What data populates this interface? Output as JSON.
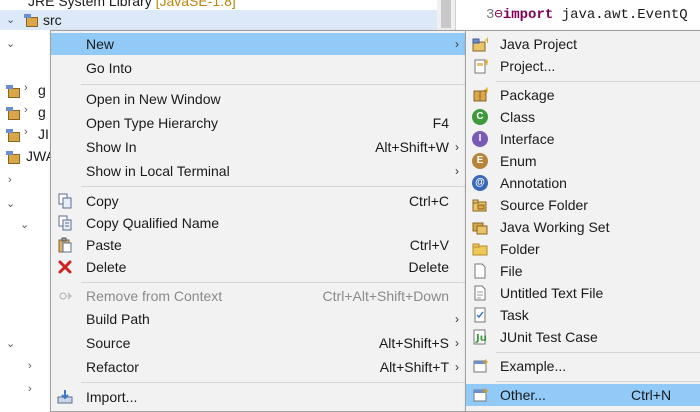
{
  "explorer": {
    "top_partial_text": "JRE System Library",
    "top_partial_tag": "[JavaSE-1.8]",
    "selected_label": "src",
    "rows": [
      {
        "arrow": "›",
        "label": "g"
      },
      {
        "arrow": "›",
        "label": "g"
      },
      {
        "arrow": "›",
        "label": "JI"
      },
      {
        "arrow": "",
        "label": "JWA"
      }
    ]
  },
  "editor": {
    "line_number": "3",
    "marker": "⊖",
    "keyword": "import",
    "code": " java.awt.EventQ"
  },
  "menu": {
    "items": [
      {
        "label": "New",
        "shortcut": "",
        "submenu": true,
        "state": "hover",
        "icon": ""
      },
      {
        "label": "Go Into",
        "shortcut": "",
        "submenu": false,
        "state": "normal",
        "icon": ""
      },
      {
        "label": "Open in New Window",
        "shortcut": "",
        "submenu": false,
        "state": "normal",
        "icon": ""
      },
      {
        "label": "Open Type Hierarchy",
        "shortcut": "F4",
        "submenu": false,
        "state": "normal",
        "icon": ""
      },
      {
        "label": "Show In",
        "shortcut": "Alt+Shift+W",
        "submenu": true,
        "state": "normal",
        "icon": ""
      },
      {
        "label": "Show in Local Terminal",
        "shortcut": "",
        "submenu": true,
        "state": "normal",
        "icon": ""
      },
      {
        "label": "Copy",
        "shortcut": "Ctrl+C",
        "submenu": false,
        "state": "normal",
        "icon": "copy-icon"
      },
      {
        "label": "Copy Qualified Name",
        "shortcut": "",
        "submenu": false,
        "state": "normal",
        "icon": "copy-qualified-icon"
      },
      {
        "label": "Paste",
        "shortcut": "Ctrl+V",
        "submenu": false,
        "state": "normal",
        "icon": "paste-icon"
      },
      {
        "label": "Delete",
        "shortcut": "Delete",
        "submenu": false,
        "state": "normal",
        "icon": "delete-icon"
      },
      {
        "label": "Remove from Context",
        "shortcut": "Ctrl+Alt+Shift+Down",
        "submenu": false,
        "state": "disabled",
        "icon": "remove-context-icon"
      },
      {
        "label": "Build Path",
        "shortcut": "",
        "submenu": true,
        "state": "normal",
        "icon": ""
      },
      {
        "label": "Source",
        "shortcut": "Alt+Shift+S",
        "submenu": true,
        "state": "normal",
        "icon": ""
      },
      {
        "label": "Refactor",
        "shortcut": "Alt+Shift+T",
        "submenu": true,
        "state": "normal",
        "icon": ""
      },
      {
        "label": "Import...",
        "shortcut": "",
        "submenu": false,
        "state": "normal",
        "icon": "import-icon"
      }
    ]
  },
  "submenu": {
    "items": [
      {
        "label": "Java Project",
        "shortcut": "",
        "icon": "java-project-icon",
        "state": "normal"
      },
      {
        "label": "Project...",
        "shortcut": "",
        "icon": "project-icon",
        "state": "normal"
      },
      {
        "label": "Package",
        "shortcut": "",
        "icon": "package-icon",
        "state": "normal"
      },
      {
        "label": "Class",
        "shortcut": "",
        "icon": "class-icon",
        "state": "normal"
      },
      {
        "label": "Interface",
        "shortcut": "",
        "icon": "interface-icon",
        "state": "normal"
      },
      {
        "label": "Enum",
        "shortcut": "",
        "icon": "enum-icon",
        "state": "normal"
      },
      {
        "label": "Annotation",
        "shortcut": "",
        "icon": "annotation-icon",
        "state": "normal"
      },
      {
        "label": "Source Folder",
        "shortcut": "",
        "icon": "source-folder-icon",
        "state": "normal"
      },
      {
        "label": "Java Working Set",
        "shortcut": "",
        "icon": "working-set-icon",
        "state": "normal"
      },
      {
        "label": "Folder",
        "shortcut": "",
        "icon": "folder-icon",
        "state": "normal"
      },
      {
        "label": "File",
        "shortcut": "",
        "icon": "file-icon",
        "state": "normal"
      },
      {
        "label": "Untitled Text File",
        "shortcut": "",
        "icon": "text-file-icon",
        "state": "normal"
      },
      {
        "label": "Task",
        "shortcut": "",
        "icon": "task-icon",
        "state": "normal"
      },
      {
        "label": "JUnit Test Case",
        "shortcut": "",
        "icon": "junit-icon",
        "state": "normal"
      },
      {
        "label": "Example...",
        "shortcut": "",
        "icon": "example-icon",
        "state": "normal"
      },
      {
        "label": "Other...",
        "shortcut": "Ctrl+N",
        "icon": "other-icon",
        "state": "hover"
      }
    ]
  }
}
